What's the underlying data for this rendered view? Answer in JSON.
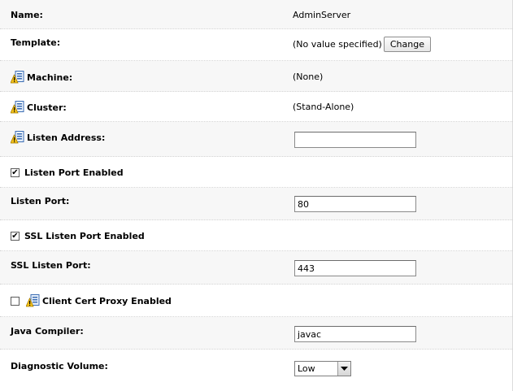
{
  "fields": {
    "name": {
      "label": "Name:",
      "value": "AdminServer"
    },
    "template": {
      "label": "Template:",
      "value": "(No value specified)",
      "button_label": "Change"
    },
    "machine": {
      "label": "Machine:",
      "value": "(None)",
      "icon": "warning-settings-icon"
    },
    "cluster": {
      "label": "Cluster:",
      "value": "(Stand-Alone)",
      "icon": "warning-settings-icon"
    },
    "listen_address": {
      "label": "Listen Address:",
      "value": "",
      "icon": "warning-settings-icon"
    },
    "listen_port_enabled": {
      "label": "Listen Port Enabled",
      "checked": true
    },
    "listen_port": {
      "label": "Listen Port:",
      "value": "80"
    },
    "ssl_listen_port_enabled": {
      "label": "SSL Listen Port Enabled",
      "checked": true
    },
    "ssl_listen_port": {
      "label": "SSL Listen Port:",
      "value": "443"
    },
    "client_cert_proxy_enabled": {
      "label": "Client Cert Proxy Enabled",
      "checked": false,
      "icon": "warning-settings-icon"
    },
    "java_compiler": {
      "label": "Java Compiler:",
      "value": "javac"
    },
    "diagnostic_volume": {
      "label": "Diagnostic Volume:",
      "value": "Low"
    }
  },
  "colors": {
    "alt_row": "#f7f7f7",
    "separator": "#d4d4d4"
  }
}
